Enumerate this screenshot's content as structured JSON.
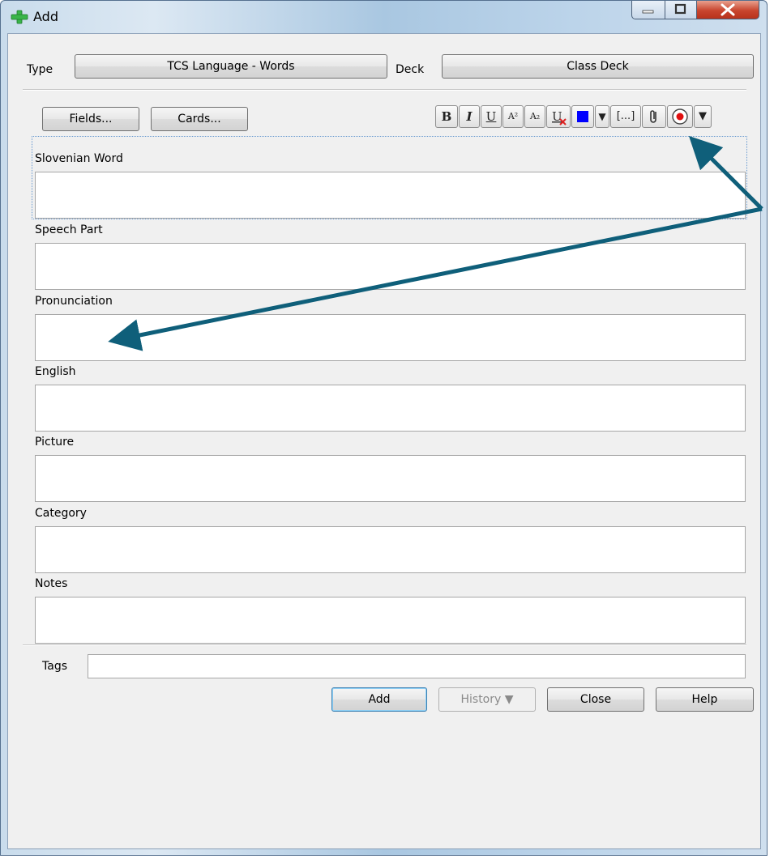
{
  "window": {
    "title": "Add",
    "accent_close": "#c8452e"
  },
  "header": {
    "type_label": "Type",
    "type_value": "TCS Language - Words",
    "deck_label": "Deck",
    "deck_value": "Class Deck"
  },
  "toolbar": {
    "fields_label": "Fields...",
    "cards_label": "Cards...",
    "format_buttons": [
      "B",
      "I",
      "U",
      "A²",
      "A₂",
      "U",
      "■",
      "▼",
      "[...]",
      "📎",
      "◉",
      "▼"
    ],
    "text_color": "#0000ff"
  },
  "fields": [
    {
      "label": "Slovenian Word",
      "value": ""
    },
    {
      "label": "Speech Part",
      "value": ""
    },
    {
      "label": "Pronunciation",
      "value": ""
    },
    {
      "label": "English",
      "value": ""
    },
    {
      "label": "Picture",
      "value": ""
    },
    {
      "label": "Category",
      "value": ""
    },
    {
      "label": "Notes",
      "value": ""
    }
  ],
  "tags": {
    "label": "Tags",
    "value": ""
  },
  "footer": {
    "add_label": "Add",
    "history_label": "History ▼",
    "close_label": "Close",
    "help_label": "Help"
  },
  "annotation": {
    "arrow_color": "#0f5f7a"
  }
}
